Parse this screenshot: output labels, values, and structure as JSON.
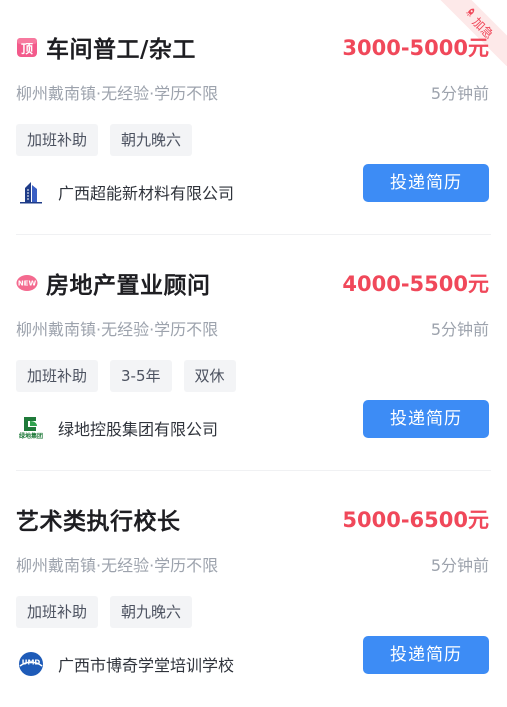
{
  "colors": {
    "salary": "#f0485a",
    "apply_button": "#3d8cf5",
    "tag_background": "#f3f4f6",
    "meta_text": "#9da3ad"
  },
  "jobs": [
    {
      "icon": "top-badge-icon",
      "title": "车间普工/杂工",
      "salary": "3000-5000元",
      "location": "柳州戴南镇·无经验·学历不限",
      "time": "5分钟前",
      "tags": [
        "加班补助",
        "朝九晚六"
      ],
      "company_logo": "building-logo-icon",
      "company": "广西超能新材料有限公司",
      "apply_label": "投递简历",
      "urgent_label": "加急"
    },
    {
      "icon": "new-badge-icon",
      "icon_text": "NEW",
      "title": "房地产置业顾问",
      "salary": "4000-5500元",
      "location": "柳州戴南镇·无经验·学历不限",
      "time": "5分钟前",
      "tags": [
        "加班补助",
        "3-5年",
        "双休"
      ],
      "company_logo": "greenland-logo-icon",
      "company_logo_text": "绿地集团",
      "company": "绿地控股集团有限公司",
      "apply_label": "投递简历"
    },
    {
      "title": "艺术类执行校长",
      "salary": "5000-6500元",
      "location": "柳州戴南镇·无经验·学历不限",
      "time": "5分钟前",
      "tags": [
        "加班补助",
        "朝九晚六"
      ],
      "company_logo": "umd-logo-icon",
      "company_logo_text": "UMD",
      "company": "广西市博奇学堂培训学校",
      "apply_label": "投递简历"
    }
  ]
}
